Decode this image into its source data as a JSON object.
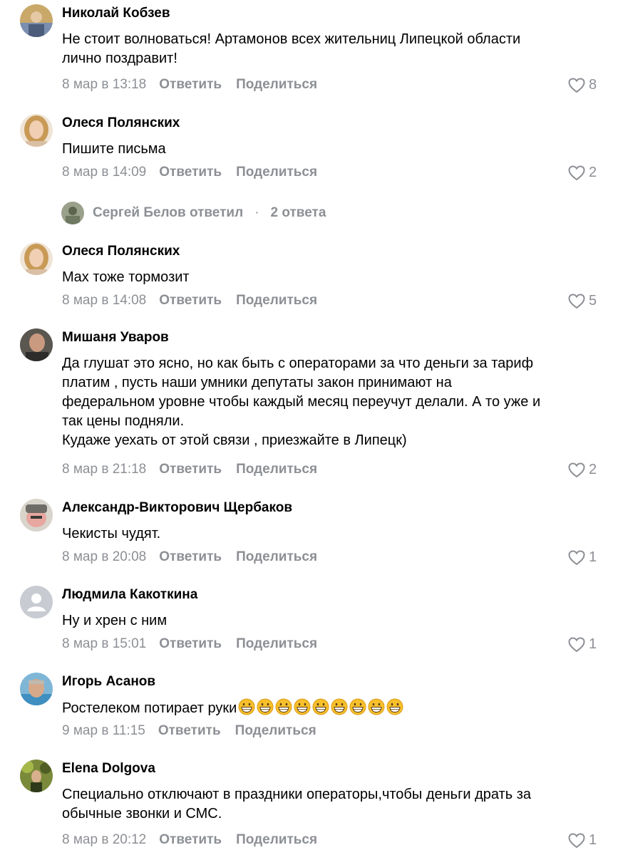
{
  "comments": [
    {
      "author": "Николай Кобзев",
      "text_lines": [
        "Не стоит волноваться! Артамонов всех жительниц Липецкой области",
        "лично поздравит!"
      ],
      "date": "8 мар в 13:18",
      "reply_label": "Ответить",
      "share_label": "Поделиться",
      "likes": "8"
    },
    {
      "author": "Олеся Полянских",
      "text_lines": [
        "Пишите письма"
      ],
      "date": "8 мар в 14:09",
      "reply_label": "Ответить",
      "share_label": "Поделиться",
      "likes": "2"
    },
    {
      "author": "Олеся Полянских",
      "text_lines": [
        "Max тоже тормозит"
      ],
      "date": "8 мар в 14:08",
      "reply_label": "Ответить",
      "share_label": "Поделиться",
      "likes": "5"
    },
    {
      "author": "Мишаня Уваров",
      "text_lines": [
        "Да глушат это ясно, но как быть с операторами за что деньги за тариф",
        "платим , пусть наши умники депутаты закон принимают на",
        "федеральном уровне чтобы каждый месяц переучут делали. А то уже и",
        "так цены подняли.",
        "Кудаже уехать от этой связи , приезжайте в Липецк)"
      ],
      "date": "8 мар в 21:18",
      "reply_label": "Ответить",
      "share_label": "Поделиться",
      "likes": "2"
    },
    {
      "author": "Александр-Викторович Щербаков",
      "text_lines": [
        "Чекисты чудят."
      ],
      "date": "8 мар в 20:08",
      "reply_label": "Ответить",
      "share_label": "Поделиться",
      "likes": "1"
    },
    {
      "author": "Людмила Какоткина",
      "text_lines": [
        "Ну и хрен с ним"
      ],
      "date": "8 мар в 15:01",
      "reply_label": "Ответить",
      "share_label": "Поделиться",
      "likes": "1"
    },
    {
      "author": "Игорь Асанов",
      "text_lines": [
        "Ростелеком потирает руки"
      ],
      "emoji": "grinning-face-emoji",
      "emoji_count": 9,
      "date": "9 мар в 11:15",
      "reply_label": "Ответить",
      "share_label": "Поделиться",
      "likes": ""
    },
    {
      "author": "Elena Dolgova",
      "text_lines": [
        "Специально отключают в праздники операторы,чтобы деньги драть за",
        "обычные звонки и СМС."
      ],
      "date": "8 мар в 20:12",
      "reply_label": "Ответить",
      "share_label": "Поделиться",
      "likes": "1"
    }
  ],
  "thread": {
    "replier": "Сергей Белов ответил",
    "separator": "·",
    "count": "2 ответа"
  },
  "colors": {
    "text": "#000000",
    "secondary": "#8c8f94",
    "placeholder_avatar": "#c8ccd2"
  },
  "icons": {
    "like": "heart-outline-icon",
    "default_avatar": "user-silhouette-icon"
  }
}
